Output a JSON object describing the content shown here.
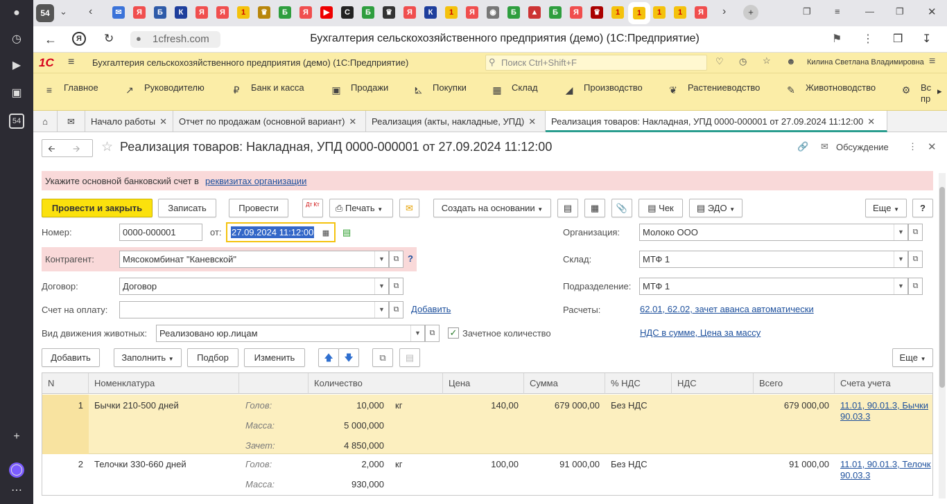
{
  "browser": {
    "sidebar_badge": "54",
    "tab_counter": "54",
    "url": "1cfresh.com",
    "page_title": "Бухгалтерия сельскохозяйственного предприятия (демо) (1С:Предприятие)"
  },
  "app": {
    "logo": "1С",
    "title": "Бухгалтерия сельскохозяйственного предприятия (демо)  (1С:Предприятие)",
    "search_placeholder": "Поиск Ctrl+Shift+F",
    "user": "Килина Светлана Владимировна"
  },
  "sections": [
    {
      "label": "Главное",
      "icon": "menu-icon"
    },
    {
      "label": "Руководителю",
      "icon": "chart-icon"
    },
    {
      "label": "Банк и касса",
      "icon": "coin-icon"
    },
    {
      "label": "Продажи",
      "icon": "bag-icon"
    },
    {
      "label": "Покупки",
      "icon": "cart-icon"
    },
    {
      "label": "Склад",
      "icon": "grid-icon"
    },
    {
      "label": "Производство",
      "icon": "factory-icon"
    },
    {
      "label": "Растениеводство",
      "icon": "leaf-icon"
    },
    {
      "label": "Животноводство",
      "icon": "cow-icon"
    },
    {
      "label": "Вс пр",
      "icon": "tractor-icon"
    }
  ],
  "open_tabs": [
    {
      "label": "Начало работы"
    },
    {
      "label": "Отчет по продажам (основной вариант)"
    },
    {
      "label": "Реализация (акты, накладные, УПД)"
    },
    {
      "label": "Реализация товаров: Накладная, УПД 0000-000001 от 27.09.2024 11:12:00"
    }
  ],
  "form": {
    "title": "Реализация товаров: Накладная, УПД 0000-000001 от 27.09.2024 11:12:00",
    "discussion": "Обсуждение",
    "warning_text": "Укажите основной банковский счет в ",
    "warning_link": "реквизитах организации",
    "buttons": {
      "post_close": "Провести и закрыть",
      "save": "Записать",
      "post": "Провести",
      "dtkt": "Дт Кт",
      "print": "Печать",
      "create_based": "Создать на основании",
      "check": "Чек",
      "edo": "ЭДО",
      "more": "Еще",
      "help": "?"
    },
    "number_label": "Номер:",
    "number_value": "0000-000001",
    "date_label": "от:",
    "date_value": "27.09.2024 11:12:00",
    "org_label": "Организация:",
    "org_value": "Молоко ООО",
    "counterparty_label": "Контрагент:",
    "counterparty_value": "Мясокомбинат \"Каневской\"",
    "warehouse_label": "Склад:",
    "warehouse_value": "МТФ 1",
    "contract_label": "Договор:",
    "contract_value": "Договор",
    "division_label": "Подразделение:",
    "division_value": "МТФ 1",
    "invoice_label": "Счет на оплату:",
    "invoice_value": "",
    "invoice_add": "Добавить",
    "settlements_label": "Расчеты:",
    "settlements_link": "62.01, 62.02, зачет аванса автоматически",
    "movement_label": "Вид движения животных:",
    "movement_value": "Реализовано юр.лицам",
    "offset_qty_label": "Зачетное количество",
    "vat_link": "НДС в сумме, Цена за массу"
  },
  "table_toolbar": {
    "add": "Добавить",
    "fill": "Заполнить",
    "pick": "Подбор",
    "change": "Изменить",
    "more": "Еще"
  },
  "table": {
    "headers": [
      "N",
      "Номенклатура",
      "",
      "Количество",
      "Цена",
      "Сумма",
      "% НДС",
      "НДС",
      "Всего",
      "Счета учета"
    ],
    "rows": [
      {
        "n": "1",
        "item": "Бычки 210-500 дней",
        "sub_labels": [
          "Голов:",
          "Масса:",
          "Зачет:"
        ],
        "sub_values": [
          "10,000",
          "5 000,000",
          "4 850,000"
        ],
        "unit": "кг",
        "price": "140,00",
        "sum": "679 000,00",
        "vat_rate": "Без НДС",
        "vat": "",
        "total": "679 000,00",
        "accounts_1": "11.01, 90.01.3, Бычки",
        "accounts_2": "90.03.3"
      },
      {
        "n": "2",
        "item": "Телочки 330-660 дней",
        "sub_labels": [
          "Голов:",
          "Масса:"
        ],
        "sub_values": [
          "2,000",
          "930,000"
        ],
        "unit": "кг",
        "price": "100,00",
        "sum": "91 000,00",
        "vat_rate": "Без НДС",
        "vat": "",
        "total": "91 000,00",
        "accounts_1": "11.01, 90.01.3, Телочк",
        "accounts_2": "90.03.3"
      }
    ]
  },
  "colors": {
    "header_bg": "#fbeda7",
    "primary_button": "#fbe10d",
    "warning_bg": "#f9d9d9",
    "selected_row": "#fcefbf",
    "link": "#1c4f9c"
  }
}
